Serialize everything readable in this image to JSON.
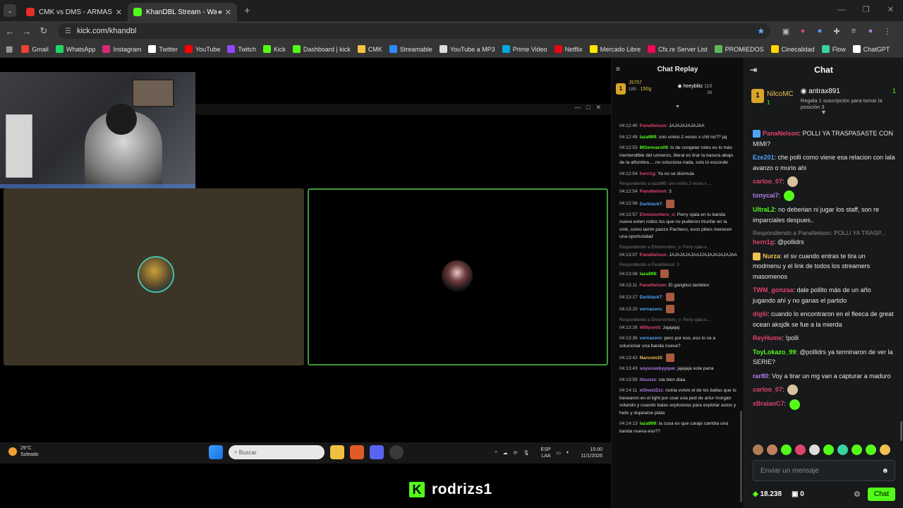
{
  "tabs": [
    {
      "title": "CMK vs DMS - ARMAS LARGAS",
      "fav": "#e52d27"
    },
    {
      "title": "KhanDBL Stream - Watch Live",
      "fav": "#53fc18"
    }
  ],
  "url": "kick.com/khandbl",
  "bookmarks": [
    "Gmail",
    "WhatsApp",
    "Instagram",
    "Twitter",
    "YouTube",
    "Twitch",
    "Kick",
    "Dashboard | kick",
    "CMK",
    "Streamable",
    "YouTube a MP3",
    "Prime Video",
    "Netflix",
    "Mercado Libre",
    "Cfx.re Server List",
    "PROMIEDOS",
    "Cinecalidad",
    "Flow",
    "ChatGPT"
  ],
  "bookmark_colors": [
    "#ea4335",
    "#25d366",
    "#d62976",
    "#ffffff",
    "#ff0000",
    "#9146ff",
    "#53fc18",
    "#53fc18",
    "#f4c542",
    "#2d8cff",
    "#dddddd",
    "#00a8e1",
    "#e50914",
    "#ffe600",
    "#f40552",
    "#5cb85c",
    "#ffd400",
    "#3ad29f",
    "#ffffff"
  ],
  "taskbar": {
    "temp": "29°C",
    "weather": "Soleado",
    "search": "Buscar",
    "lang1": "ESP",
    "lang2": "LAA",
    "time": "15:00",
    "date": "11/1/2026"
  },
  "streamer": {
    "logo": "K",
    "name": "rodrizs1"
  },
  "replay": {
    "title": "Chat Replay",
    "rank1": {
      "medal": "1",
      "name": "J5757",
      "sub1": "185",
      "sub2": "150g"
    },
    "rank2": {
      "name": "heeyblitz",
      "sub1": "110",
      "sub2": "26"
    },
    "messages": [
      {
        "reply": "",
        "ts": "04:12:40",
        "user": "PanaNelson",
        "color": "#e0436c",
        "text": "JAJAJAJAJAJAA"
      },
      {
        "reply": "",
        "ts": "04:12:48",
        "user": "laza999",
        "color": "#53fc18",
        "text": "uno volvio 2 veces x chit no?? jaj"
      },
      {
        "reply": "",
        "ts": "04:12:53",
        "user": "MGennaro09",
        "color": "#53fc18",
        "text": "lo de congelar roles es lo más inentendible del universo, literal es tirar la basura abajo de la alfombra.... no soluciona nada, solo lo esconde"
      },
      {
        "reply": "",
        "ts": "04:12:54",
        "user": "hern1g",
        "color": "#e0436c",
        "text": "Ya no se disimula"
      },
      {
        "reply": "Respondiendo a laza999: uno volvio 2 veces x ...",
        "ts": "04:12:54",
        "user": "PanaNelson",
        "color": "#e0436c",
        "text": "3"
      },
      {
        "reply": "",
        "ts": "04:12:56",
        "user": "Darblack7",
        "color": "#4fa3f7",
        "text": ""
      },
      {
        "reply": "",
        "ts": "04:12:57",
        "user": "Elvismontero_o",
        "color": "#e0436c",
        "text": "Perry ojala en tu banda nueva esten rodos los que no pudieron triunfar en la cmk, como lamin panzo Pacheco, esos pibes merecen una oportunidad"
      },
      {
        "reply": "Respondiendo a Elvismontero_o: Perry ojala e...",
        "ts": "04:13:07",
        "user": "PanaNelson",
        "color": "#e0436c",
        "text": "JAJAJAJAJAAJJAJAJAJAJAJAA"
      },
      {
        "reply": "Respondiendo a PanaNelson: 3",
        "ts": "04:13:08",
        "user": "laza999",
        "color": "#53fc18",
        "text": ""
      },
      {
        "reply": "",
        "ts": "04:13:11",
        "user": "PanaNelson",
        "color": "#e0436c",
        "text": "El ganglios tambien"
      },
      {
        "reply": "",
        "ts": "04:13:17",
        "user": "Darblack7",
        "color": "#4fa3f7",
        "text": ""
      },
      {
        "reply": "",
        "ts": "04:13:20",
        "user": "vernazero",
        "color": "#4fa3f7",
        "text": ""
      },
      {
        "reply": "Respondiendo a Elvismontero_o: Perry ojala e...",
        "ts": "04:13:26",
        "user": "Willysmit",
        "color": "#e0436c",
        "text": "Jajajajaj"
      },
      {
        "reply": "",
        "ts": "04:13:36",
        "user": "vernazero",
        "color": "#4fa3f7",
        "text": "pero por eso, eso lo va a solucionar una banda nueva?"
      },
      {
        "reply": "",
        "ts": "04:13:42",
        "user": "Narcom10",
        "color": "#f0c050",
        "text": ""
      },
      {
        "reply": "",
        "ts": "04:13:43",
        "user": "soyscoobyyque",
        "color": "#b07de8",
        "text": "jajajaja este pana"
      },
      {
        "reply": "",
        "ts": "04:13:59",
        "user": "lilsuvzz",
        "color": "#b07de8",
        "text": "ola bien diaa"
      },
      {
        "reply": "",
        "ts": "04:14:11",
        "user": "xGhostZzz",
        "color": "#b07de8",
        "text": "nutria volvio el de los ballas que lo banearon en el light por usar una ped de artur morgan volando y usando balas explosivas para explotar autos y helis y dupearse plata"
      },
      {
        "reply": "",
        "ts": "04:14:13",
        "user": "laza999",
        "color": "#53fc18",
        "text": "la cosa es que carajo cambia una banda nueva eso??"
      }
    ]
  },
  "chat": {
    "title": "Chat",
    "rank1": {
      "medal": "1",
      "name": "NilcoMC",
      "sub": "1"
    },
    "rank2": {
      "name": "antrax891",
      "count": "1",
      "promo": "Regala 1 suscripción para tomar la posición 3"
    },
    "messages": [
      {
        "reply": "",
        "user": "PanaNelson",
        "color": "#e0436c",
        "badge": "#4fa3f7",
        "text": "POLLI YA TRASPASASTE CON MIMI?"
      },
      {
        "reply": "",
        "user": "Eze201",
        "color": "#4fa3f7",
        "badge": "",
        "text": "che polli como viene esa relacion con lala avanzo o murio ahi"
      },
      {
        "reply": "",
        "user": "carloo_07",
        "color": "#e0436c",
        "badge": "",
        "text": ""
      },
      {
        "reply": "",
        "user": "tonycai7",
        "color": "#b07de8",
        "badge": "",
        "text": ""
      },
      {
        "reply": "",
        "user": "UltraL2",
        "color": "#53fc18",
        "badge": "",
        "text": "no deberian ni jugar los staff, son re imparciales despues.."
      },
      {
        "reply": "Respondiendo a PanaNelson: POLLI YA TRASP...",
        "user": "hern1g",
        "color": "#e0436c",
        "badge": "",
        "text": "@pollidrs"
      },
      {
        "reply": "",
        "user": "Nurza",
        "color": "#f0c050",
        "badge": "#f0c050",
        "text": "el sv cuando entras te tira un modmenu y el link de todos los streamers masomenos"
      },
      {
        "reply": "",
        "user": "TWM_gonzaa",
        "color": "#e0436c",
        "badge": "",
        "text": "dale pollito más de un año jugando ahí y no ganas el partido"
      },
      {
        "reply": "",
        "user": "diglii",
        "color": "#e0436c",
        "badge": "",
        "text": "cuando lo encontraron en el fleeca de great ocean aksjdk se fue a la mierda"
      },
      {
        "reply": "",
        "user": "ReyHume",
        "color": "#e0436c",
        "badge": "",
        "text": "!polli"
      },
      {
        "reply": "",
        "user": "ToyLokazo_99",
        "color": "#53fc18",
        "badge": "",
        "text": "@pollidrs ya terminaron de ver la SERIE?"
      },
      {
        "reply": "",
        "user": "rar80",
        "color": "#b07de8",
        "badge": "",
        "text": "Voy a tirar un mg van a capturar a maduro"
      },
      {
        "reply": "",
        "user": "carloo_07",
        "color": "#e0436c",
        "badge": "",
        "text": ""
      },
      {
        "reply": "",
        "user": "xBraianC7",
        "color": "#e0436c",
        "badge": "",
        "text": ""
      }
    ],
    "input_placeholder": "Enviar un mensaje",
    "points": "18.238",
    "count": "0",
    "send": "Chat"
  }
}
